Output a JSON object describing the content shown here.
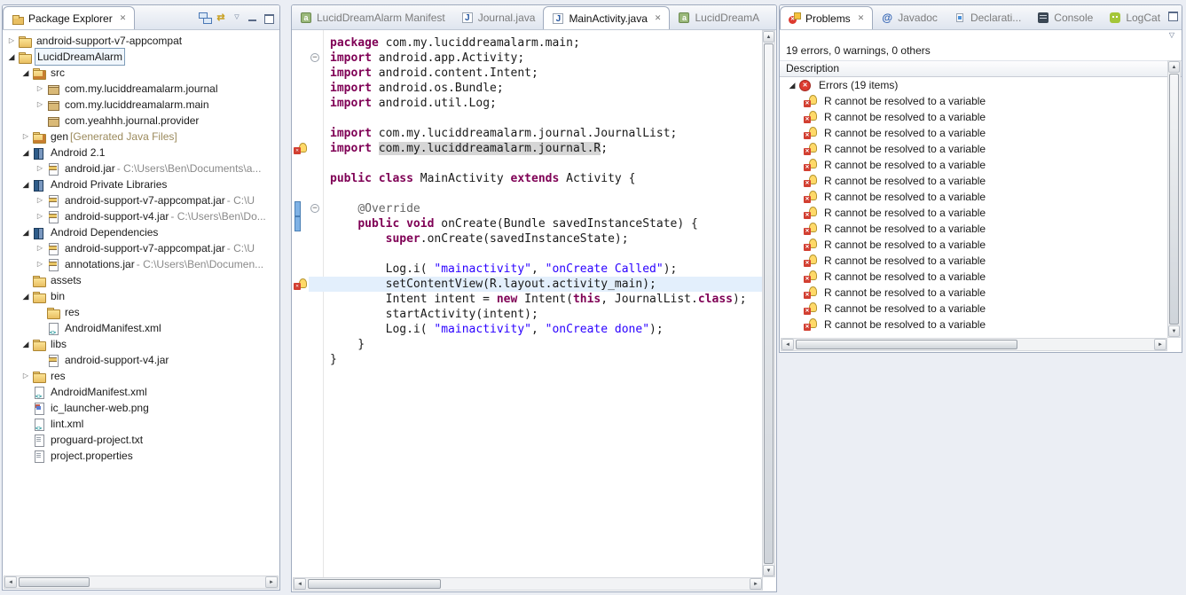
{
  "colors": {
    "keyword": "#7f0055",
    "string": "#2a00ff",
    "annotation": "#646464",
    "occurrence_highlight": "#d6d6d6",
    "current_line": "#e3effc",
    "error_red": "#dd3b2f",
    "quickfix_yellow": "#ffd968",
    "panel_border": "#a0abbe",
    "selection_border": "#7f9db9"
  },
  "package_explorer": {
    "tab": "Package Explorer",
    "toolbar_icons": [
      "collapse-all",
      "link-editor",
      "view-menu",
      "minimize",
      "maximize"
    ],
    "tree": [
      {
        "indent": 0,
        "arrow": "collapsed",
        "icon": "project",
        "label": "android-support-v7-appcompat"
      },
      {
        "indent": 0,
        "arrow": "expanded",
        "icon": "project",
        "label": "LucidDreamAlarm",
        "selected": true
      },
      {
        "indent": 1,
        "arrow": "expanded",
        "icon": "src",
        "label": "src"
      },
      {
        "indent": 2,
        "arrow": "collapsed",
        "icon": "package",
        "label": "com.my.luciddreamalarm.journal"
      },
      {
        "indent": 2,
        "arrow": "collapsed",
        "icon": "package",
        "label": "com.my.luciddreamalarm.main"
      },
      {
        "indent": 2,
        "arrow": "none",
        "icon": "package",
        "label": "com.yeahhh.journal.provider"
      },
      {
        "indent": 1,
        "arrow": "collapsed",
        "icon": "src",
        "label": "gen",
        "suffix": " [Generated Java Files]"
      },
      {
        "indent": 1,
        "arrow": "expanded",
        "icon": "library",
        "label": "Android 2.1"
      },
      {
        "indent": 2,
        "arrow": "collapsed",
        "icon": "jar",
        "label": "android.jar",
        "suffix": " - C:\\Users\\Ben\\Documents\\a..."
      },
      {
        "indent": 1,
        "arrow": "expanded",
        "icon": "library",
        "label": "Android Private Libraries"
      },
      {
        "indent": 2,
        "arrow": "collapsed",
        "icon": "jar",
        "label": "android-support-v7-appcompat.jar",
        "suffix": " - C:\\U"
      },
      {
        "indent": 2,
        "arrow": "collapsed",
        "icon": "jar",
        "label": "android-support-v4.jar",
        "suffix": " - C:\\Users\\Ben\\Do..."
      },
      {
        "indent": 1,
        "arrow": "expanded",
        "icon": "library",
        "label": "Android Dependencies"
      },
      {
        "indent": 2,
        "arrow": "collapsed",
        "icon": "jar",
        "label": "android-support-v7-appcompat.jar",
        "suffix": " - C:\\U"
      },
      {
        "indent": 2,
        "arrow": "collapsed",
        "icon": "jar",
        "label": "annotations.jar",
        "suffix": " - C:\\Users\\Ben\\Documen..."
      },
      {
        "indent": 1,
        "arrow": "none",
        "icon": "folder",
        "label": "assets"
      },
      {
        "indent": 1,
        "arrow": "expanded",
        "icon": "folder",
        "label": "bin"
      },
      {
        "indent": 2,
        "arrow": "none",
        "icon": "folder",
        "label": "res"
      },
      {
        "indent": 2,
        "arrow": "none",
        "icon": "xml",
        "label": "AndroidManifest.xml"
      },
      {
        "indent": 1,
        "arrow": "expanded",
        "icon": "folder",
        "label": "libs"
      },
      {
        "indent": 2,
        "arrow": "none",
        "icon": "jar",
        "label": "android-support-v4.jar"
      },
      {
        "indent": 1,
        "arrow": "collapsed",
        "icon": "folder",
        "label": "res"
      },
      {
        "indent": 1,
        "arrow": "none",
        "icon": "xml",
        "label": "AndroidManifest.xml"
      },
      {
        "indent": 1,
        "arrow": "none",
        "icon": "image",
        "label": "ic_launcher-web.png"
      },
      {
        "indent": 1,
        "arrow": "none",
        "icon": "xml",
        "label": "lint.xml"
      },
      {
        "indent": 1,
        "arrow": "none",
        "icon": "text",
        "label": "proguard-project.txt"
      },
      {
        "indent": 1,
        "arrow": "none",
        "icon": "text",
        "label": "project.properties"
      }
    ]
  },
  "editor": {
    "tabs": [
      {
        "label": "LucidDreamAlarm Manifest",
        "icon": "manifest"
      },
      {
        "label": "Journal.java",
        "icon": "java"
      },
      {
        "label": "MainActivity.java",
        "icon": "java",
        "active": true,
        "closable": true
      },
      {
        "label": "LucidDreamA",
        "icon": "manifest"
      }
    ],
    "lines": [
      {
        "tokens": [
          [
            "k",
            "package"
          ],
          [
            "p",
            " com.my.luciddreamalarm.main;"
          ]
        ]
      },
      {
        "fold": true,
        "tokens": [
          [
            "k",
            "import"
          ],
          [
            "p",
            " android.app.Activity;"
          ]
        ]
      },
      {
        "tokens": [
          [
            "k",
            "import"
          ],
          [
            "p",
            " android.content.Intent;"
          ]
        ]
      },
      {
        "tokens": [
          [
            "k",
            "import"
          ],
          [
            "p",
            " android.os.Bundle;"
          ]
        ]
      },
      {
        "tokens": [
          [
            "k",
            "import"
          ],
          [
            "p",
            " android.util.Log;"
          ]
        ]
      },
      {
        "tokens": []
      },
      {
        "tokens": [
          [
            "k",
            "import"
          ],
          [
            "p",
            " com.my.luciddreamalarm.journal.JournalList;"
          ]
        ]
      },
      {
        "error": true,
        "tokens": [
          [
            "k",
            "import"
          ],
          [
            "p",
            " "
          ],
          [
            "hl",
            "com.my.luciddreamalarm.journal.R"
          ],
          [
            "p",
            ";"
          ]
        ]
      },
      {
        "tokens": []
      },
      {
        "tokens": [
          [
            "k",
            "public"
          ],
          [
            "p",
            " "
          ],
          [
            "k",
            "class"
          ],
          [
            "p",
            " MainActivity "
          ],
          [
            "k",
            "extends"
          ],
          [
            "p",
            " Activity {"
          ]
        ]
      },
      {
        "tokens": []
      },
      {
        "fold": true,
        "cyan": true,
        "tokens": [
          [
            "p",
            "    "
          ],
          [
            "a",
            "@Override"
          ]
        ]
      },
      {
        "cyan": true,
        "tokens": [
          [
            "p",
            "    "
          ],
          [
            "k",
            "public"
          ],
          [
            "p",
            " "
          ],
          [
            "k",
            "void"
          ],
          [
            "p",
            " onCreate(Bundle savedInstanceState) {"
          ]
        ]
      },
      {
        "tokens": [
          [
            "p",
            "        "
          ],
          [
            "k",
            "super"
          ],
          [
            "p",
            ".onCreate(savedInstanceState);"
          ]
        ]
      },
      {
        "tokens": []
      },
      {
        "tokens": [
          [
            "p",
            "        Log.i( "
          ],
          [
            "s",
            "\"mainactivity\""
          ],
          [
            "p",
            ", "
          ],
          [
            "s",
            "\"onCreate Called\""
          ],
          [
            "p",
            ");"
          ]
        ]
      },
      {
        "error": true,
        "current": true,
        "tokens": [
          [
            "p",
            "        setContentView(R.layout.activity_main);"
          ]
        ]
      },
      {
        "tokens": [
          [
            "p",
            "        Intent intent = "
          ],
          [
            "k",
            "new"
          ],
          [
            "p",
            " Intent("
          ],
          [
            "k",
            "this"
          ],
          [
            "p",
            ", JournalList."
          ],
          [
            "k",
            "class"
          ],
          [
            "p",
            ");"
          ]
        ]
      },
      {
        "tokens": [
          [
            "p",
            "        startActivity(intent);"
          ]
        ]
      },
      {
        "tokens": [
          [
            "p",
            "        Log.i( "
          ],
          [
            "s",
            "\"mainactivity\""
          ],
          [
            "p",
            ", "
          ],
          [
            "s",
            "\"onCreate done\""
          ],
          [
            "p",
            ");"
          ]
        ]
      },
      {
        "tokens": [
          [
            "p",
            "    }"
          ]
        ]
      },
      {
        "tokens": [
          [
            "p",
            "}"
          ]
        ]
      }
    ]
  },
  "problems": {
    "tabs": [
      {
        "label": "Problems",
        "icon": "problems",
        "active": true,
        "closable": true
      },
      {
        "label": "Javadoc",
        "icon": "javadoc"
      },
      {
        "label": "Declarati...",
        "icon": "declaration"
      },
      {
        "label": "Console",
        "icon": "console"
      },
      {
        "label": "LogCat",
        "icon": "logcat"
      }
    ],
    "summary": "19 errors, 0 warnings, 0 others",
    "column_header": "Description",
    "group": "Errors (19 items)",
    "items": [
      "R cannot be resolved to a variable",
      "R cannot be resolved to a variable",
      "R cannot be resolved to a variable",
      "R cannot be resolved to a variable",
      "R cannot be resolved to a variable",
      "R cannot be resolved to a variable",
      "R cannot be resolved to a variable",
      "R cannot be resolved to a variable",
      "R cannot be resolved to a variable",
      "R cannot be resolved to a variable",
      "R cannot be resolved to a variable",
      "R cannot be resolved to a variable",
      "R cannot be resolved to a variable",
      "R cannot be resolved to a variable",
      "R cannot be resolved to a variable"
    ]
  }
}
